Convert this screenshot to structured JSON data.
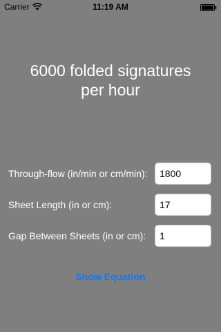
{
  "status_bar": {
    "carrier": "Carrier",
    "time": "11:19 AM",
    "wifi_icon": "wifi-icon",
    "battery_icon": "battery-icon"
  },
  "result": {
    "line1": "6000 folded signatures",
    "line2": "per hour"
  },
  "form": {
    "through_flow": {
      "label": "Through-flow (in/min or cm/min):",
      "value": "1800"
    },
    "sheet_length": {
      "label": "Sheet Length (in or cm):",
      "value": "17"
    },
    "gap": {
      "label": "Gap Between Sheets (in or cm):",
      "value": "1"
    }
  },
  "show_equation_label": "Show Equation",
  "colors": {
    "background": "#7f7f7f",
    "link": "#0a7aff"
  }
}
